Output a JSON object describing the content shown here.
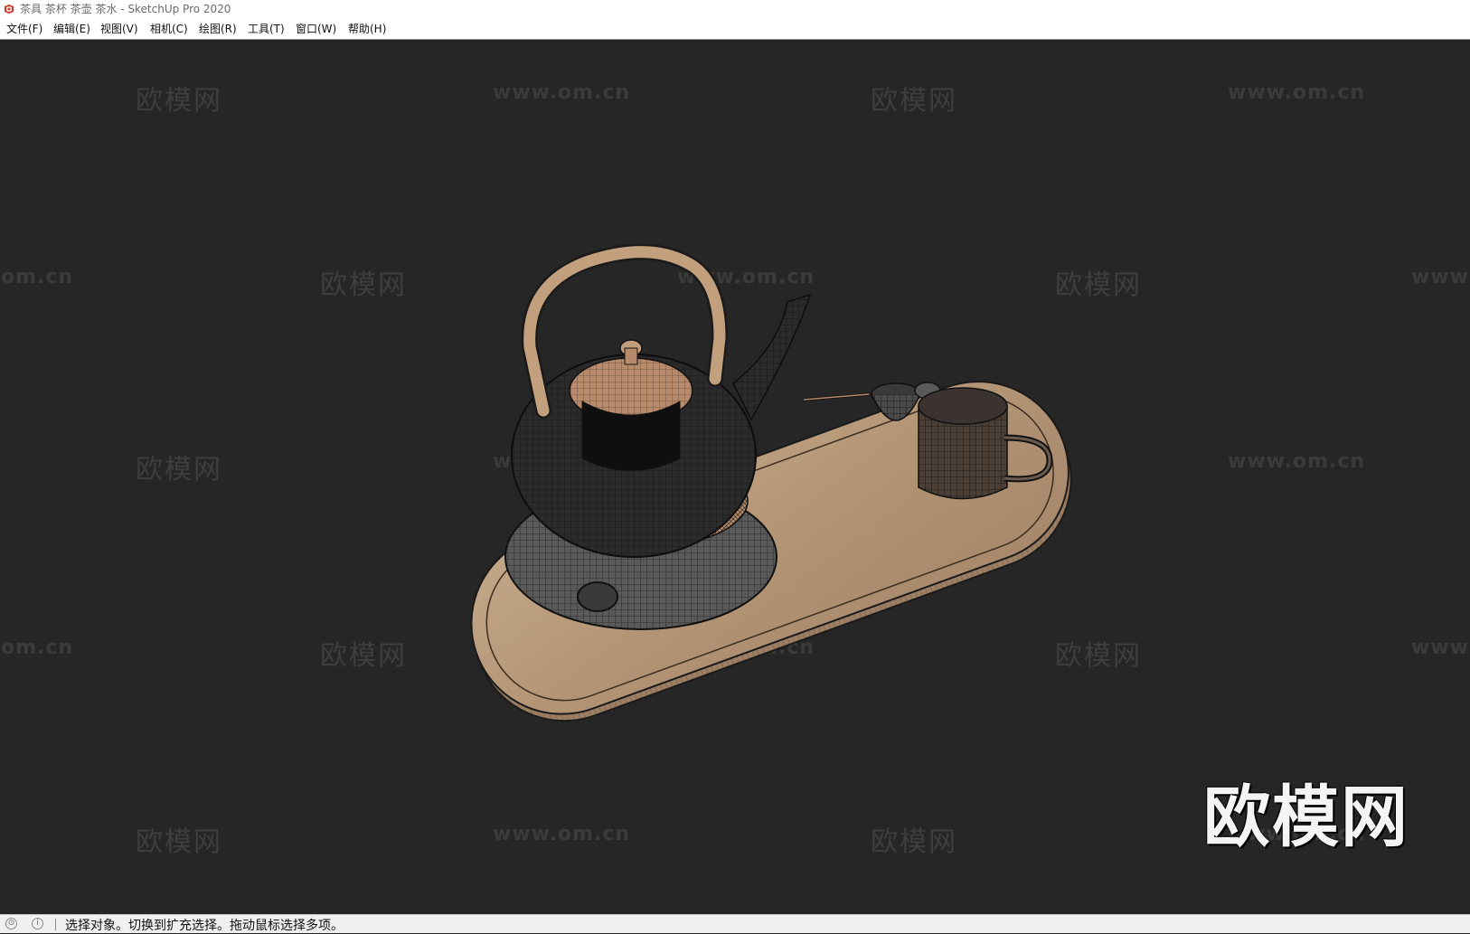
{
  "window": {
    "title": "茶具 茶杯 茶壶 茶水 - SketchUp Pro 2020",
    "app_icon": "sketchup-logo-icon",
    "accent_color": "#d9312b"
  },
  "menu": {
    "items": [
      "文件(F)",
      "编辑(E)",
      "视图(V)",
      "相机(C)",
      "绘图(R)",
      "工具(T)",
      "窗口(W)",
      "帮助(H)"
    ]
  },
  "viewport": {
    "background": "#262626",
    "model": "teapot-on-wooden-tray-wireframe",
    "watermarks": {
      "site": "www.om.cn",
      "site_partial_left": "om.cn",
      "site_partial_right": "www.",
      "brand": "欧模网"
    },
    "brand_logo": "欧模网"
  },
  "status": {
    "icons": [
      "geolocation-icon",
      "info-icon"
    ],
    "text": "选择对象。切换到扩充选择。拖动鼠标选择多项。"
  }
}
